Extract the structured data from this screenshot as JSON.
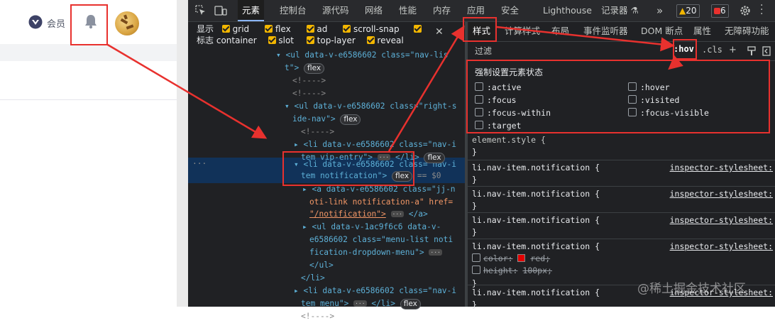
{
  "page": {
    "vip_label": "会员"
  },
  "devtools": {
    "tabs": [
      "元素",
      "控制台",
      "源代码",
      "网络",
      "性能",
      "内存",
      "应用",
      "安全",
      "Lighthouse",
      "记录器 ⚗"
    ],
    "more": "»",
    "warnings": "20",
    "errors": "6",
    "options_row1": {
      "label": "显示",
      "items": [
        "grid",
        "flex",
        "ad",
        "scroll-snap"
      ]
    },
    "options_row2": {
      "label": "标志",
      "items": [
        "container",
        "slot",
        "top-layer",
        "reveal"
      ]
    },
    "dom": {
      "l1a": "<ul data-v-e6586602 class=\"nav-lis",
      "l1b": "t\">",
      "c1": "<!---->",
      "c2": "<!---->",
      "l2a": "<ul data-v-e6586602 class=\"right-s",
      "l2b": "ide-nav\">",
      "c3": "<!---->",
      "l3a": "<li data-v-e6586602 class=\"nav-i",
      "l3b": "tem vip-entry\">",
      "l3c": "</li>",
      "l4a": "<li data-v-e6586602 class=\"nav-i",
      "l4b": "tem notification\">",
      "l4c": "== $0",
      "l5a": "<a data-v-e6586602 class=\"jj-n",
      "l5b": "oti-link notification-a\" href=",
      "l5c": "\"/notification\">",
      "l5d": "</a>",
      "l6a": "<ul data-v-1ac9f6c6 data-v-",
      "l6b": "e6586602 class=\"menu-list noti",
      "l6c": "fication-dropdown-menu\">",
      "l6d": "</ul>",
      "l6e": "</li>",
      "l7a": "<li data-v-e6586602 class=\"nav-i",
      "l7b": "tem menu\">",
      "l7c": "</li>",
      "l8": "<!---->",
      "badge_flex": "flex",
      "dots": "···"
    },
    "styles": {
      "tabs": [
        "样式",
        "计算样式",
        "布局",
        "事件监听器",
        "DOM 断点",
        "属性",
        "无障碍功能"
      ],
      "filter": "过滤",
      "hov": ":hov",
      "cls": ".cls",
      "force_title": "强制设置元素状态",
      "states_left": [
        ":active",
        ":focus",
        ":focus-within",
        ":target"
      ],
      "states_right": [
        ":hover",
        ":visited",
        ":focus-visible"
      ],
      "element_style": "element.style {",
      "close_brace": "}",
      "rule_selector": "li.nav-item.notification {",
      "rule_source": "inspector-stylesheet:",
      "prop1_name": "color:",
      "prop1_value": "red;",
      "prop2_name": "height:",
      "prop2_value": "100px;",
      "red_color": "#e30000"
    },
    "watermark": "@稀土掘金技术社区"
  }
}
